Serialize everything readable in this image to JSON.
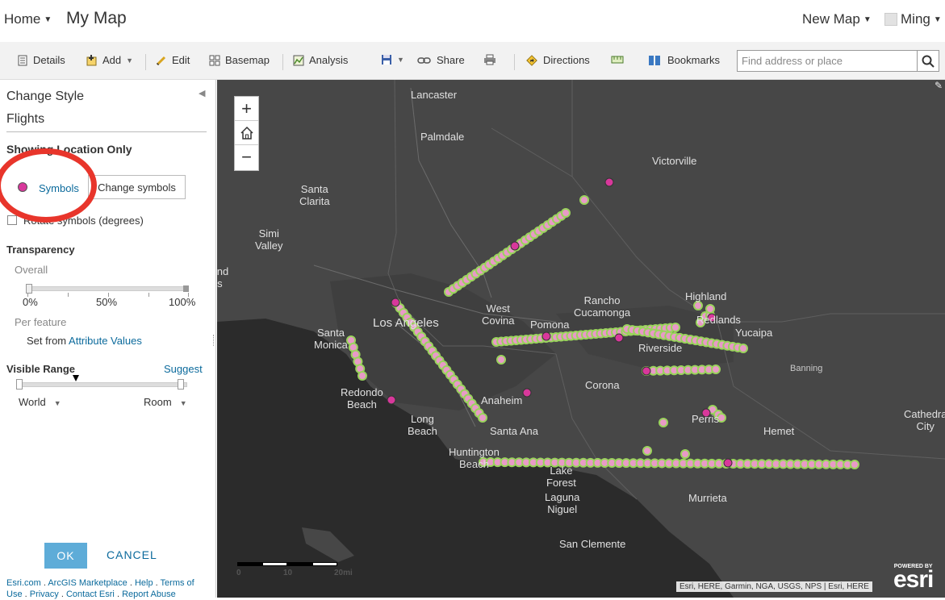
{
  "header": {
    "home_label": "Home",
    "map_title": "My Map",
    "new_map_label": "New Map",
    "user_label": "Ming"
  },
  "toolbar": {
    "details": "Details",
    "add": "Add",
    "edit": "Edit",
    "basemap": "Basemap",
    "analysis": "Analysis",
    "share": "Share",
    "directions": "Directions",
    "bookmarks": "Bookmarks",
    "search_placeholder": "Find address or place"
  },
  "panel": {
    "title": "Change Style",
    "layer": "Flights",
    "showing": "Showing Location Only",
    "symbols_link": "Symbols",
    "change_symbols": "Change symbols",
    "rotate_label": "Rotate symbols (degrees)",
    "transparency": "Transparency",
    "overall": "Overall",
    "overall_value_percent": 0,
    "tick_0": "0%",
    "tick_50": "50%",
    "tick_100": "100%",
    "per_feature": "Per feature",
    "set_from": "Set from",
    "attribute_values": "Attribute Values",
    "visible_range": "Visible Range",
    "suggest": "Suggest",
    "range_min": "World",
    "range_max": "Room",
    "ok": "OK",
    "cancel": "CANCEL",
    "footer": {
      "esri_com": "Esri.com",
      "marketplace": "ArcGIS Marketplace",
      "help": "Help",
      "terms": "Terms of Use",
      "privacy": "Privacy",
      "contact": "Contact Esri",
      "report": "Report Abuse"
    }
  },
  "map": {
    "cities": [
      "Lancaster",
      "Palmdale",
      "Victorville",
      "Santa Clarita",
      "Simi Valley",
      "Thousand Oaks",
      "Los Angeles",
      "Santa Monica",
      "West Covina",
      "Pomona",
      "Rancho Cucamonga",
      "Highland",
      "Redlands",
      "Yucaipa",
      "Riverside",
      "Banning",
      "Corona",
      "Redondo Beach",
      "Anaheim",
      "Long Beach",
      "Santa Ana",
      "Huntington Beach",
      "Perris",
      "Hemet",
      "Cathedral City",
      "Lake Forest",
      "Laguna Niguel",
      "Murrieta",
      "San Clemente"
    ],
    "scale": {
      "s0": "0",
      "s10": "10",
      "s20": "20mi"
    },
    "attribution": "Esri, HERE, Garmin, NGA, USGS, NPS | Esri, HERE",
    "powered_by": "POWERED BY",
    "esri_logo": "esri",
    "symbol_color": "#d8389b",
    "flight_color": "#e89ac7",
    "flight_halo_color": "#9ad45c"
  }
}
